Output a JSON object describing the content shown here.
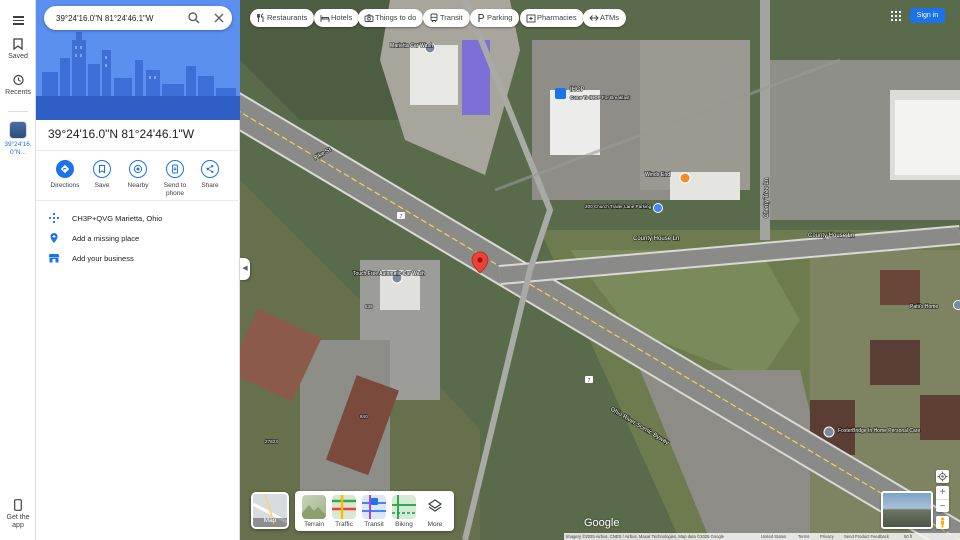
{
  "rail": {
    "saved_label": "Saved",
    "recents_label": "Recents",
    "place_label": "39°24'16.0\"N...",
    "get_app_label": "Get the app"
  },
  "search": {
    "value": "39°24'16.0\"N 81°24'46.1\"W"
  },
  "place": {
    "title": "39°24'16.0\"N 81°24'46.1\"W",
    "actions": {
      "directions": "Directions",
      "save": "Save",
      "nearby": "Nearby",
      "send_to_phone": "Send to phone",
      "share": "Share"
    },
    "rows": {
      "plus_code": "CH3P+QVG Marietta, Ohio",
      "add_missing_place": "Add a missing place",
      "add_business": "Add your business"
    }
  },
  "chips": [
    {
      "label": "Restaurants",
      "icon": "fork-knife-icon"
    },
    {
      "label": "Hotels",
      "icon": "bed-icon"
    },
    {
      "label": "Things to do",
      "icon": "camera-icon"
    },
    {
      "label": "Transit",
      "icon": "train-icon"
    },
    {
      "label": "Parking",
      "icon": "parking-icon"
    },
    {
      "label": "Pharmacies",
      "icon": "pharmacy-icon"
    },
    {
      "label": "ATMs",
      "icon": "atm-icon"
    }
  ],
  "header": {
    "sign_in": "Sign in"
  },
  "map_labels": {
    "car_wash": "Marietta Car Wash",
    "ihop": "IHOP",
    "ihop_sub": "Come To IHOP For Breakfast",
    "winds_end": "Winds End",
    "winds_address": "200 Church Trailer Lane Parking",
    "touch_free": "Touch Free Automatic Car Wash",
    "pike_st": "Pike St",
    "county_house_ln": "County House Ln",
    "cherry_tree_ln": "Cherry Tree Ln",
    "ohio_river_byway": "Ohio River Scenic Byway",
    "route": "7",
    "route_2": "7",
    "fosterbridge": "FosterBridge In Home Personal Care",
    "pattis": "Patti's Home",
    "house_number_1": "840",
    "house_number_2": "27823",
    "house_number_3": "838"
  },
  "layers": {
    "map": "Map",
    "terrain": "Terrain",
    "traffic": "Traffic",
    "transit": "Transit",
    "biking": "Biking",
    "more": "More"
  },
  "footer": {
    "google": "Google",
    "imagery": "Imagery ©2025 Airbus, CNES / Airbus, Maxar Technologies, Map data ©2025 Google",
    "region": "United States",
    "terms": "Terms",
    "privacy": "Privacy",
    "feedback": "Send Product Feedback",
    "scale": "50 ft"
  },
  "colors": {
    "accent": "#1a73e8",
    "pin": "#ea4335",
    "road": "#8a8a88",
    "road_edge": "#d9d9d5"
  }
}
